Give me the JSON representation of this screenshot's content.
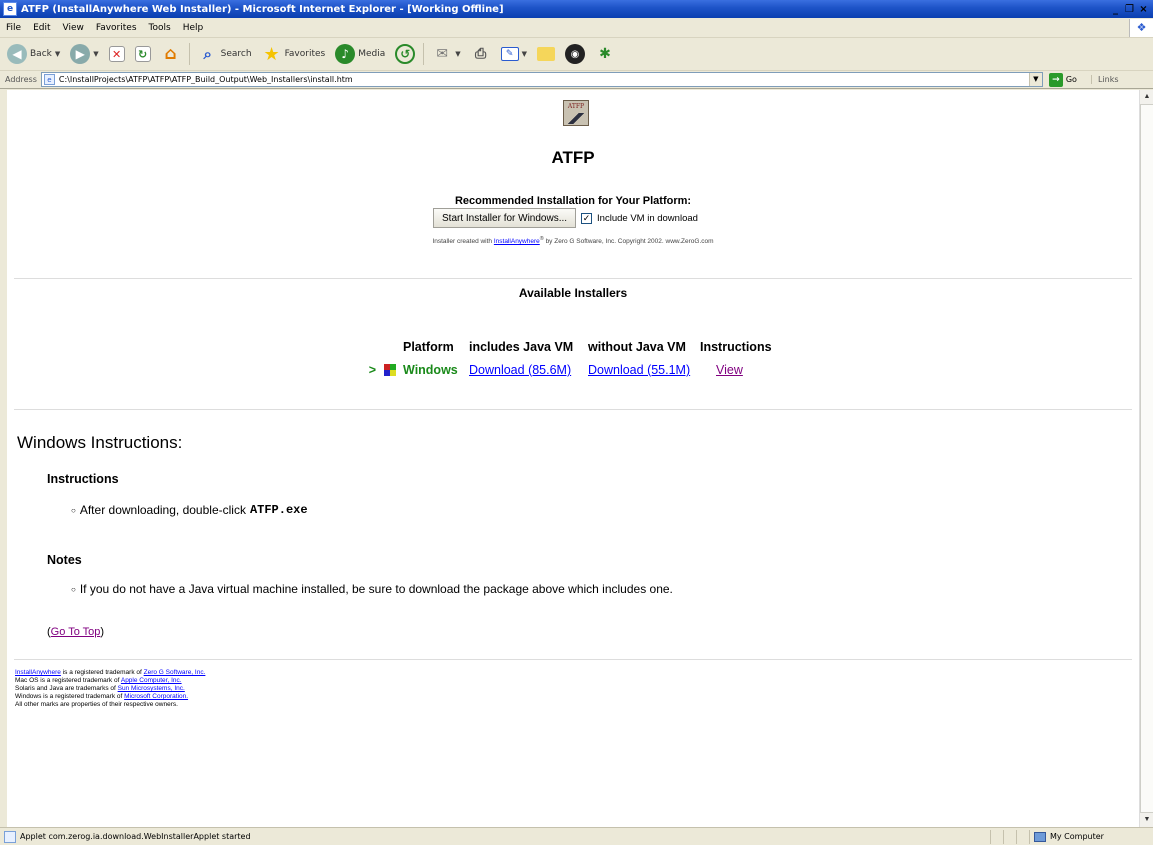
{
  "window": {
    "title": "ATFP (InstallAnywhere Web Installer) - Microsoft Internet Explorer - [Working Offline]",
    "controls": [
      "_",
      "❐",
      "×"
    ]
  },
  "menu": [
    "File",
    "Edit",
    "View",
    "Favorites",
    "Tools",
    "Help"
  ],
  "toolbar": {
    "back_label": "Back",
    "search_label": "Search",
    "favorites_label": "Favorites",
    "media_label": "Media"
  },
  "address": {
    "label": "Address",
    "url": "C:\\InstallProjects\\ATFP\\ATFP\\ATFP_Build_Output\\Web_Installers\\install.htm",
    "go_label": "Go",
    "links_label": "Links"
  },
  "page": {
    "logo_text": "ATFP",
    "title": "ATFP",
    "recommended_heading": "Recommended Installation for Your Platform:",
    "start_button": "Start Installer for Windows...",
    "include_vm_label": "Include VM in download",
    "include_vm_checked": true,
    "credit_prefix": "Installer created with",
    "credit_link": "InstallAnywhere",
    "credit_reg": "®",
    "credit_suffix": "by Zero G Software, Inc. Copyright 2002.  www.ZeroG.com",
    "available_heading": "Available Installers",
    "table": {
      "headers": [
        "Platform",
        "includes Java VM",
        "without Java VM",
        "Instructions"
      ],
      "rows": [
        {
          "arrow": ">",
          "platform": "Windows",
          "with_vm": "Download (85.6M)",
          "without_vm": "Download (55.1M)",
          "instructions": "View"
        }
      ]
    },
    "windows_instructions_heading": "Windows Instructions:",
    "instructions_subheading": "Instructions",
    "instruction_text": "After downloading, double-click",
    "instruction_file": "ATFP.exe",
    "notes_subheading": "Notes",
    "note_text": "If you do not have a Java virtual machine installed, be sure to download the package above which includes one.",
    "go_to_top_open": "(",
    "go_to_top": "Go To Top",
    "go_to_top_close": ")",
    "footer": [
      {
        "link": "InstallAnywhere",
        "text": " is a registered trademark of ",
        "link2": "Zero G Software, Inc."
      },
      {
        "text": "Mac OS is a registered trademark of ",
        "link2": "Apple Computer, Inc."
      },
      {
        "text": "Solaris and Java are trademarks of ",
        "link2": "Sun Microsystems, Inc."
      },
      {
        "text": "Windows is a registered trademark of ",
        "link2": "Microsoft Corporation."
      },
      {
        "text": "All other marks are properties of their respective owners."
      }
    ]
  },
  "status": {
    "text": "Applet com.zerog.ia.download.WebInstallerApplet started",
    "zone": "My Computer"
  }
}
